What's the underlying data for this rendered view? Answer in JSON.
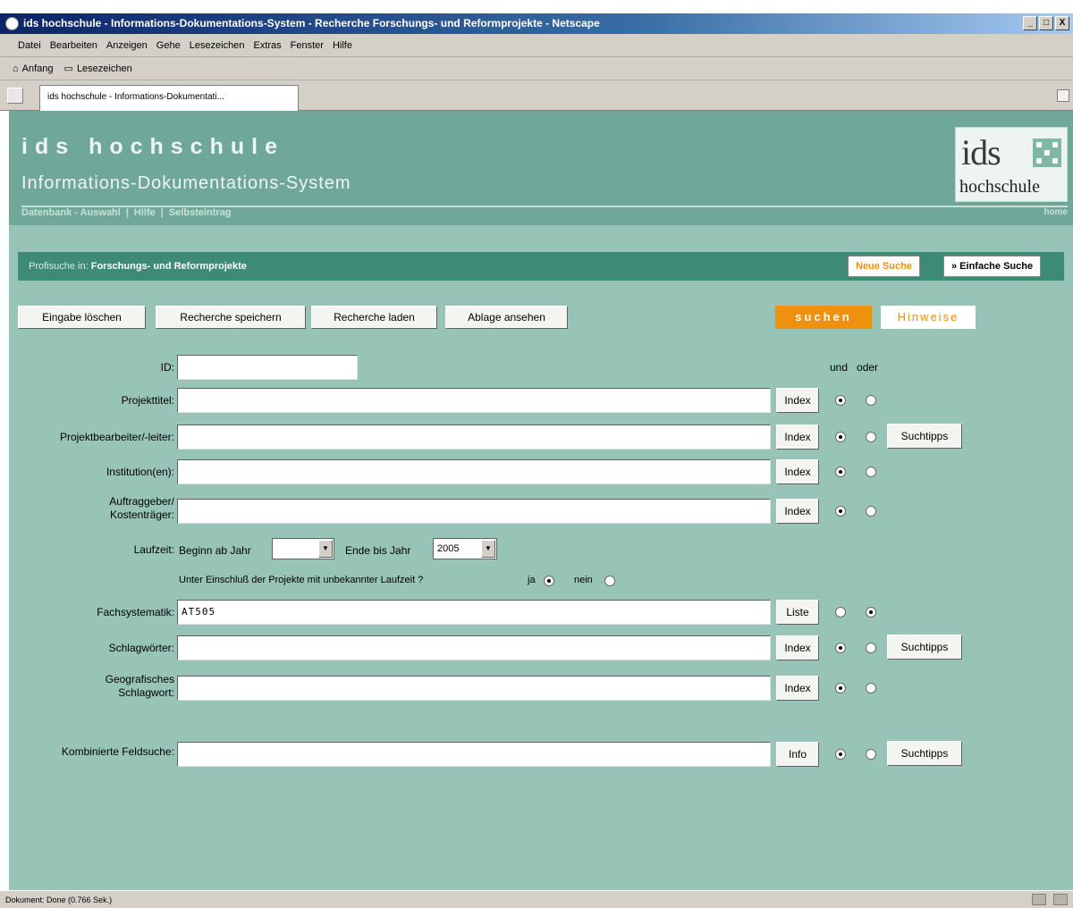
{
  "window": {
    "title": "ids hochschule - Informations-Dokumentations-System - Recherche Forschungs- und Reformprojekte - Netscape",
    "buttons": [
      "_",
      "□",
      "X"
    ]
  },
  "menu": [
    "Datei",
    "Bearbeiten",
    "Anzeigen",
    "Gehe",
    "Lesezeichen",
    "Extras",
    "Fenster",
    "Hilfe"
  ],
  "bookmarks": {
    "home": "Anfang",
    "bookmarks": "Lesezeichen"
  },
  "tab": {
    "label": "ids hochschule - Informations-Dokumentati..."
  },
  "header": {
    "title": "ids hochschule",
    "subtitle": "Informations-Dokumentations-System",
    "nav": [
      "Datenbank - Auswahl",
      "Hilfe",
      "Selbsteintrag"
    ],
    "home": "home",
    "logo_top": "ids",
    "logo_bottom": "hochschule"
  },
  "profibar": {
    "prefix": "Profisuche in:",
    "db": "Forschungs- und Reformprojekte",
    "new_search": "Neue Suche",
    "simple_search": "» Einfache Suche"
  },
  "actions": {
    "clear": "Eingabe löschen",
    "save": "Recherche speichern",
    "load": "Recherche laden",
    "view": "Ablage ansehen",
    "search": "suchen",
    "hints": "Hinweise"
  },
  "andor": {
    "und": "und",
    "oder": "oder"
  },
  "fields": {
    "id": {
      "label": "ID:",
      "value": ""
    },
    "projekttitel": {
      "label": "Projekttitel:",
      "value": "",
      "btn": "Index",
      "und": true
    },
    "bearbeiter": {
      "label": "Projektbearbeiter/-leiter:",
      "value": "",
      "btn": "Index",
      "und": true,
      "tips": "Suchtipps"
    },
    "institution": {
      "label": "Institution(en):",
      "value": "",
      "btn": "Index",
      "und": true
    },
    "auftraggeber": {
      "label_1": "Auftraggeber/",
      "label_2": "Kostenträger:",
      "value": "",
      "btn": "Index",
      "und": true
    },
    "laufzeit": {
      "label": "Laufzeit:",
      "begin_label": "Beginn ab Jahr",
      "begin_value": "",
      "end_label": "Ende bis Jahr",
      "end_value": "2005",
      "unknown_label": "Unter Einschluß der Projekte mit unbekannter Laufzeit ?",
      "ja": "ja",
      "nein": "nein",
      "selected": "ja"
    },
    "fachsystematik": {
      "label": "Fachsystematik:",
      "value": "AT505",
      "btn": "Liste",
      "und": false
    },
    "schlagwoerter": {
      "label": "Schlagwörter:",
      "value": "",
      "btn": "Index",
      "und": true,
      "tips": "Suchtipps"
    },
    "geo": {
      "label_1": "Geografisches",
      "label_2": "Schlagwort:",
      "value": "",
      "btn": "Index",
      "und": true
    },
    "kombi": {
      "label": "Kombinierte Feldsuche:",
      "value": "",
      "btn": "Info",
      "und": true,
      "tips": "Suchtipps"
    }
  },
  "status": "Dokument: Done (0.766 Sek.)",
  "colors": {
    "page_bg": "#97c4b6",
    "header_bg": "#6fa898",
    "bar_bg": "#3d8a75",
    "accent": "#f0900f"
  }
}
